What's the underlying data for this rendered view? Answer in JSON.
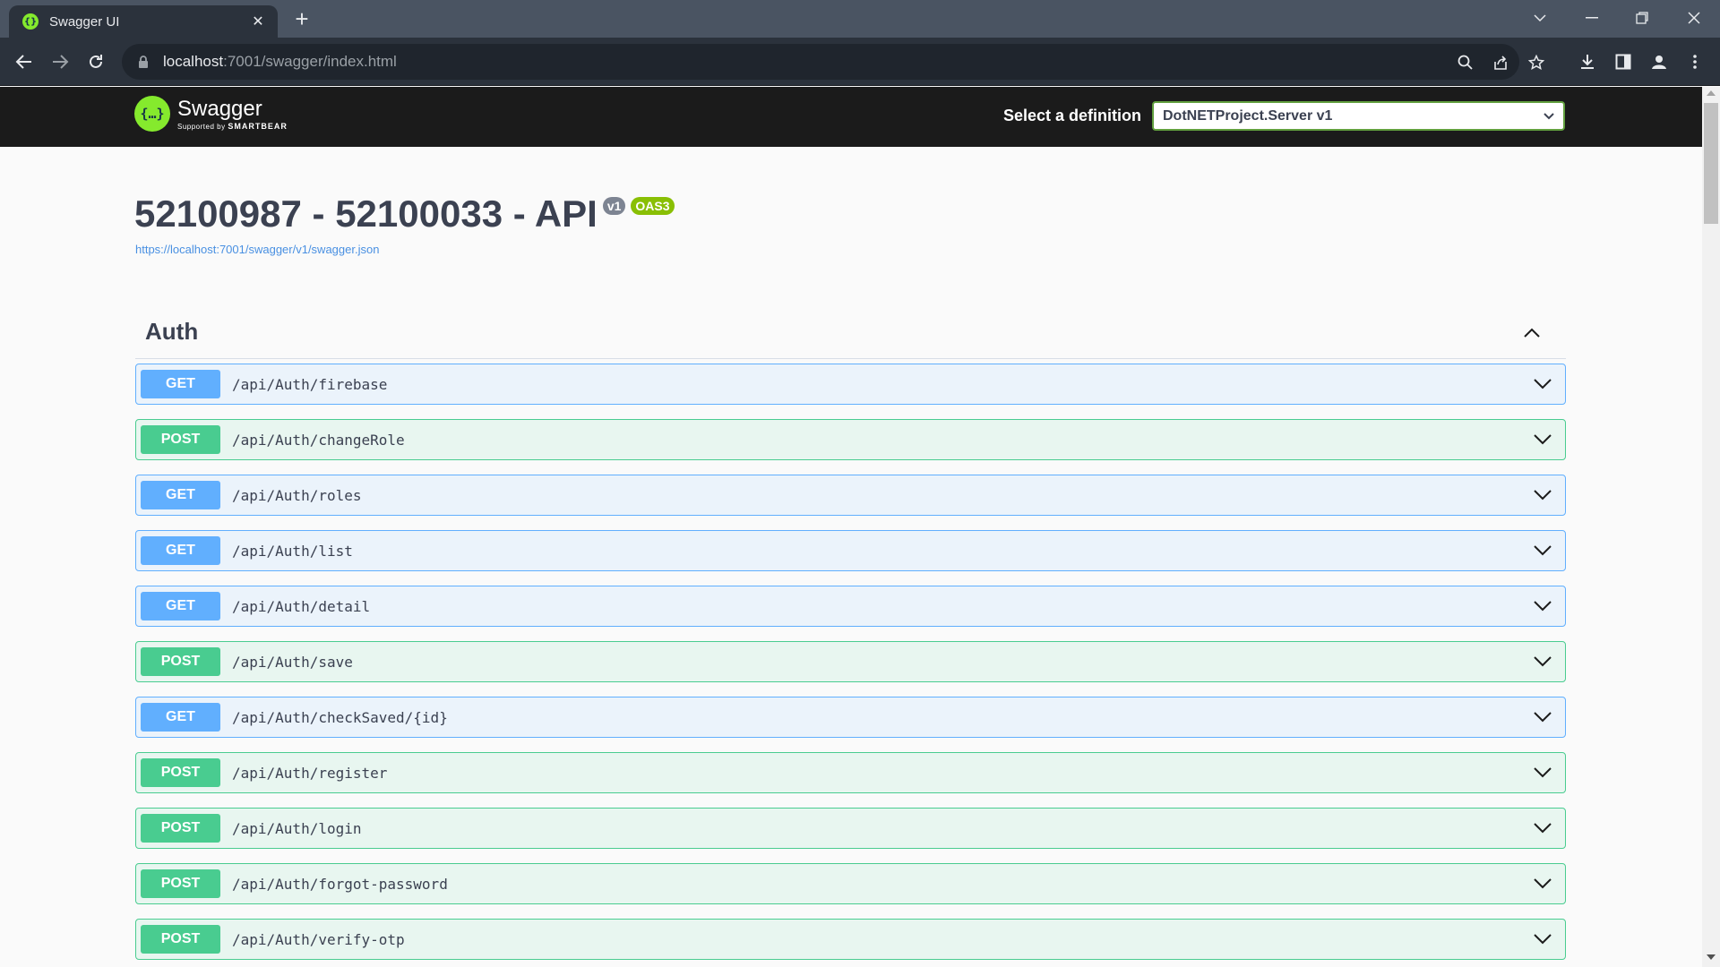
{
  "browser": {
    "tab_title": "Swagger UI",
    "url_host": "localhost",
    "url_rest": ":7001/swagger/index.html"
  },
  "topbar": {
    "logo_name": "Swagger",
    "logo_sub_prefix": "Supported by",
    "logo_sub_brand": "SMARTBEAR",
    "definition_label": "Select a definition",
    "definition_value": "DotNETProject.Server v1"
  },
  "info": {
    "title": "52100987 - 52100033 - API",
    "version_badge": "v1",
    "oas_badge": "OAS3",
    "spec_url": "https://localhost:7001/swagger/v1/swagger.json"
  },
  "tag": {
    "name": "Auth"
  },
  "operations": [
    {
      "method": "GET",
      "path": "/api/Auth/firebase"
    },
    {
      "method": "POST",
      "path": "/api/Auth/changeRole"
    },
    {
      "method": "GET",
      "path": "/api/Auth/roles"
    },
    {
      "method": "GET",
      "path": "/api/Auth/list"
    },
    {
      "method": "GET",
      "path": "/api/Auth/detail"
    },
    {
      "method": "POST",
      "path": "/api/Auth/save"
    },
    {
      "method": "GET",
      "path": "/api/Auth/checkSaved/{id}"
    },
    {
      "method": "POST",
      "path": "/api/Auth/register"
    },
    {
      "method": "POST",
      "path": "/api/Auth/login"
    },
    {
      "method": "POST",
      "path": "/api/Auth/forgot-password"
    },
    {
      "method": "POST",
      "path": "/api/Auth/verify-otp"
    }
  ],
  "colors": {
    "get": "#61affe",
    "post": "#49cc90",
    "swagger_green": "#85ea2d"
  }
}
